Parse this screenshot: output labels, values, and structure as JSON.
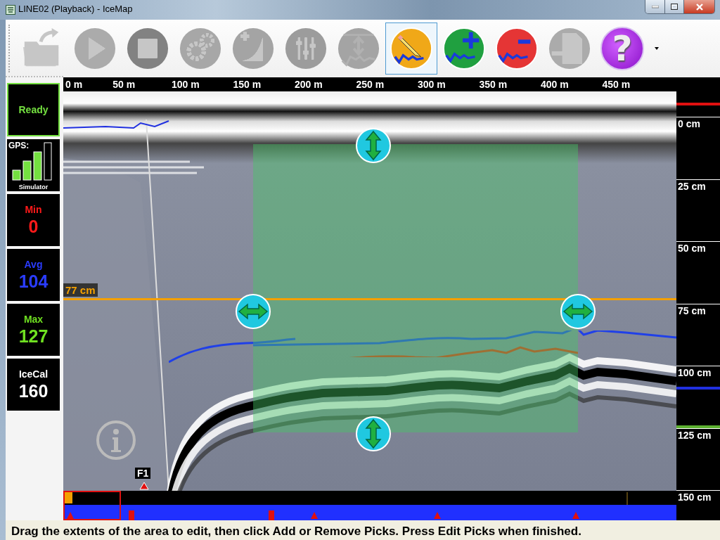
{
  "window": {
    "title": "LINE02 (Playback) - IceMap"
  },
  "toolbar": {
    "buttons": [
      {
        "kind": "open",
        "disabled": true,
        "selected": false
      },
      {
        "kind": "play",
        "disabled": true,
        "selected": false
      },
      {
        "kind": "stop",
        "disabled": true,
        "selected": false
      },
      {
        "kind": "settings",
        "disabled": true,
        "selected": false
      },
      {
        "kind": "calibrate",
        "disabled": true,
        "selected": false
      },
      {
        "kind": "adjust",
        "disabled": true,
        "selected": false
      },
      {
        "kind": "depth",
        "disabled": true,
        "selected": false
      },
      {
        "kind": "edit",
        "disabled": false,
        "selected": true
      },
      {
        "kind": "add",
        "disabled": false,
        "selected": false
      },
      {
        "kind": "remove",
        "disabled": false,
        "selected": false
      },
      {
        "kind": "export",
        "disabled": true,
        "selected": false
      },
      {
        "kind": "help",
        "disabled": false,
        "selected": false,
        "glyph": "?"
      }
    ]
  },
  "sidebar": {
    "status": "Ready",
    "gps": {
      "label": "GPS:",
      "source": "Simulator"
    },
    "stats": [
      {
        "label": "Min",
        "value": "0",
        "color": "#ff1a1a"
      },
      {
        "label": "Avg",
        "value": "104",
        "color": "#2a3cff"
      },
      {
        "label": "Max",
        "value": "127",
        "color": "#6fe021"
      },
      {
        "label": "IceCal",
        "value": "160",
        "color": "#ffffff"
      }
    ]
  },
  "distance_axis": {
    "ticks": [
      "0 m",
      "50 m",
      "100 m",
      "150 m",
      "200 m",
      "250 m",
      "300 m",
      "350 m",
      "400 m",
      "450 m"
    ]
  },
  "radargram": {
    "depth_readout": "77 cm",
    "flag": "F1"
  },
  "depth_axis": {
    "ticks": [
      "0 cm",
      "25 cm",
      "50 cm",
      "75 cm",
      "100 cm",
      "125 cm",
      "150 cm"
    ]
  },
  "status_bar": {
    "text": "Drag the extents of the area to edit, then click Add or Remove Picks. Press Edit Picks when finished."
  }
}
